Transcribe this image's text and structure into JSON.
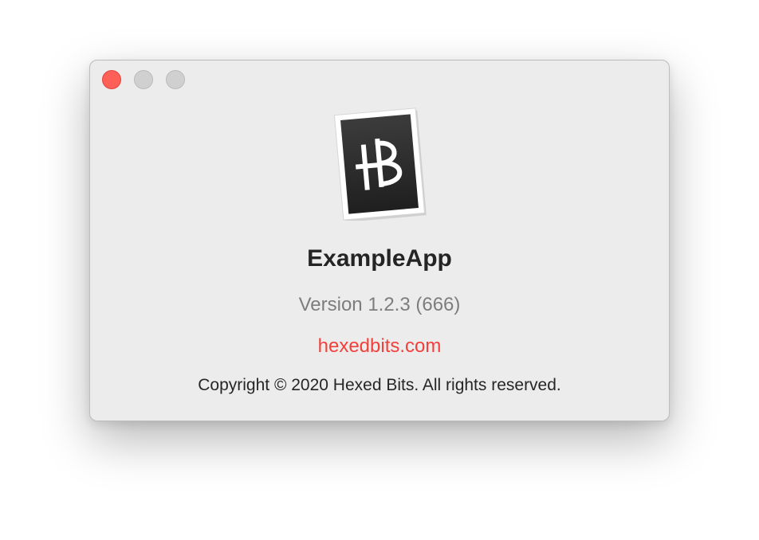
{
  "window": {
    "buttons": {
      "close": "close-icon",
      "minimize": "minimize-icon",
      "zoom": "zoom-icon"
    }
  },
  "about": {
    "icon": "hexedbits-app-icon",
    "icon_letters": "HB",
    "app_name": "ExampleApp",
    "version": "Version 1.2.3 (666)",
    "website": "hexedbits.com",
    "copyright": "Copyright © 2020 Hexed Bits. All rights reserved."
  },
  "colors": {
    "close": "#fe5f57",
    "link": "#f2403a",
    "window_bg": "#ececec",
    "icon_dark": "#2e2e2e"
  }
}
